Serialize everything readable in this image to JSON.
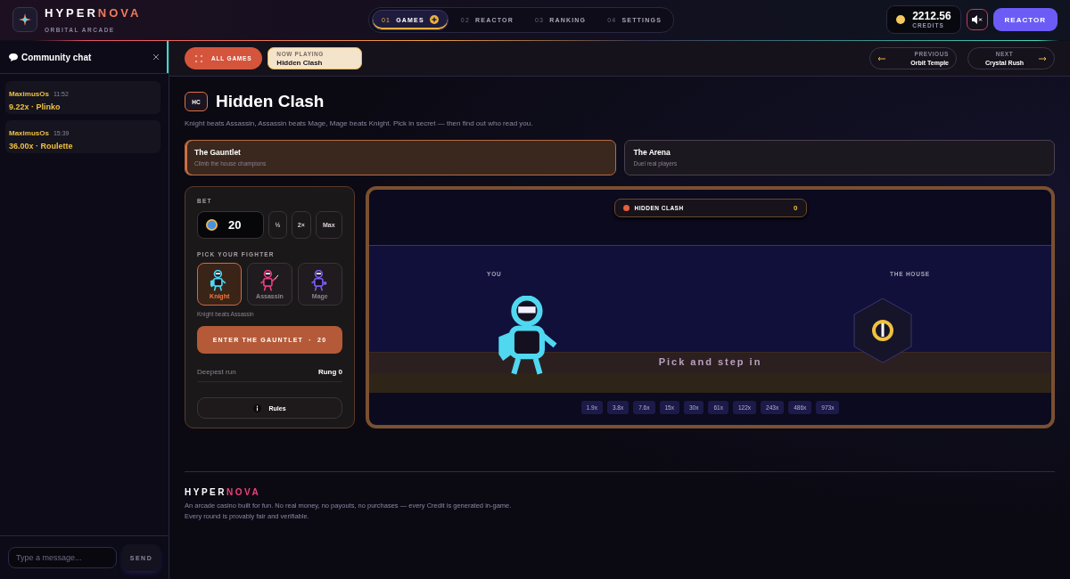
{
  "header": {
    "brand_main": "HYPER",
    "brand_accent": "NOVA",
    "tagline": "ORBITAL ARCADE",
    "nav": [
      {
        "number": "01",
        "label": "GAMES",
        "selected": true
      },
      {
        "number": "02",
        "label": "REACTOR",
        "selected": false
      },
      {
        "number": "03",
        "label": "RANKING",
        "selected": false
      },
      {
        "number": "04",
        "label": "SETTINGS",
        "selected": false
      }
    ],
    "credits": {
      "amount": "2212.56",
      "label": "CREDITS"
    },
    "muted": true,
    "action_button": "REACTOR"
  },
  "chat": {
    "title": "Community chat",
    "messages": [
      {
        "user": "MaximusOs",
        "time": "11:52",
        "text": "9.22x · Plinko"
      },
      {
        "user": "MaximusOs",
        "time": "15:39",
        "text": "36.00x · Roulette"
      }
    ],
    "input": {
      "placeholder": "Type a message..."
    },
    "send_button": "SEND"
  },
  "toolbar": {
    "all_games_button": "ALL GAMES",
    "now_playing": {
      "label": "NOW PLAYING",
      "title": "Hidden Clash"
    },
    "previous": {
      "label": "PREVIOUS",
      "title": "Orbit Temple"
    },
    "next": {
      "label": "NEXT",
      "title": "Crystal Rush"
    }
  },
  "game": {
    "badge": "HC",
    "title": "Hidden Clash",
    "description": "Knight beats Assassin, Assassin beats Mage, Mage beats Knight. Pick in secret — then find out who read you.",
    "modes": [
      {
        "title": "The Gauntlet",
        "subtitle": "Climb the house champions",
        "selected": true
      },
      {
        "title": "The Arena",
        "subtitle": "Duel real players",
        "selected": false
      }
    ],
    "bet": {
      "label": "BET",
      "value": "20",
      "buttons": [
        "½",
        "2×",
        "Max"
      ]
    },
    "fighter_label": "PICK YOUR FIGHTER",
    "fighters": [
      {
        "name": "Knight",
        "color": "#4fd8f0",
        "selected": true
      },
      {
        "name": "Assassin",
        "color": "#e8407c",
        "selected": false
      },
      {
        "name": "Mage",
        "color": "#7c5cf0",
        "selected": false
      }
    ],
    "hint": "Knight beats Assassin",
    "enter_button": "ENTER THE GAUNTLET  ·  20",
    "stats": [
      {
        "label": "Deepest run",
        "value": "Rung 0"
      }
    ],
    "rules_button": "Rules"
  },
  "stage": {
    "title": "HIDDEN CLASH",
    "score": "0",
    "player_label": "YOU",
    "house_label": "THE HOUSE",
    "prompt": "Pick and step in",
    "multipliers": [
      "1.9x",
      "3.8x",
      "7.6x",
      "15x",
      "30x",
      "61x",
      "122x",
      "243x",
      "486x",
      "973x"
    ]
  },
  "footer": {
    "brand_main": "HYPER",
    "brand_accent": "NOVA",
    "text": "An arcade casino built for fun. No real money, no payouts, no purchases — every Credit is generated in-game. Every round is provably fair and verifiable."
  }
}
